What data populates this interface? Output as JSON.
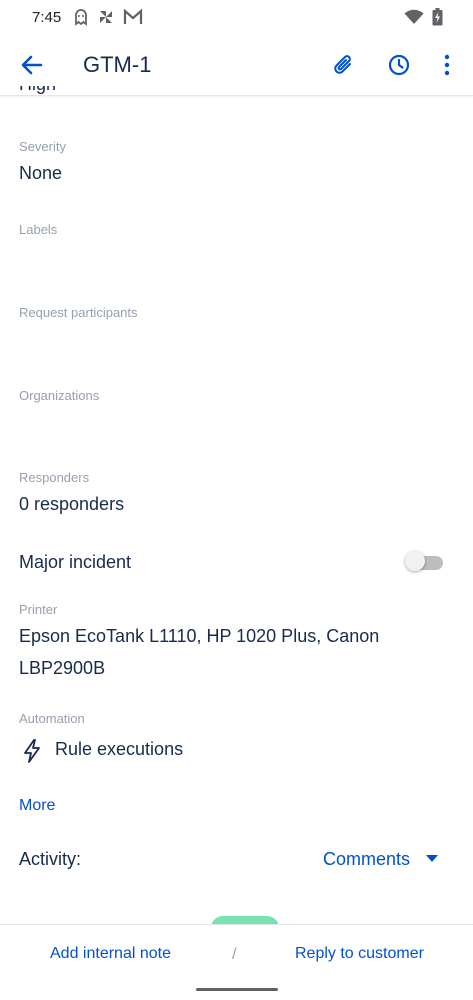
{
  "status_bar": {
    "time": "7:45",
    "left_icons": [
      "ghost-icon",
      "pinwheel-icon",
      "gmail-icon"
    ],
    "right_icons": [
      "wifi-icon",
      "battery-charging-icon"
    ]
  },
  "app_bar": {
    "title": "GTM-1",
    "actions": [
      "attachment-icon",
      "history-icon",
      "more-vert-icon"
    ]
  },
  "fields": {
    "priority_partial": "High",
    "severity": {
      "label": "Severity",
      "value": "None"
    },
    "labels": {
      "label": "Labels"
    },
    "request_participants": {
      "label": "Request participants"
    },
    "organizations": {
      "label": "Organizations"
    },
    "responders": {
      "label": "Responders",
      "value": "0 responders"
    },
    "major_incident": {
      "label": "Major incident",
      "enabled": false
    },
    "printer": {
      "label": "Printer",
      "value_line1": "Epson EcoTank L1110, HP 1020 Plus, Canon",
      "value_line2": "LBP2900B"
    },
    "automation": {
      "label": "Automation",
      "item": "Rule executions"
    }
  },
  "more_link": "More",
  "activity": {
    "label": "Activity:",
    "selected": "Comments"
  },
  "bottom_bar": {
    "add_internal_note": "Add internal note",
    "separator": "/",
    "reply_to_customer": "Reply to customer"
  },
  "colors": {
    "primary": "#0052cc",
    "text": "#172b4d",
    "label": "#97a0af",
    "fab": "#79e2b0"
  }
}
